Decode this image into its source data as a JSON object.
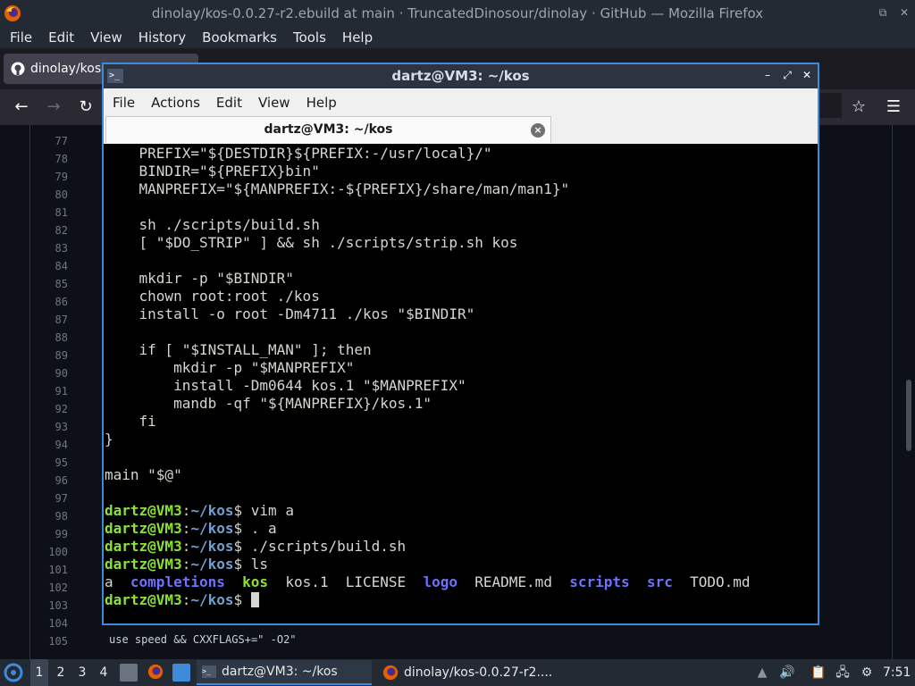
{
  "firefox": {
    "window_title": "dinolay/kos-0.0.27-r2.ebuild at main · TruncatedDinosour/dinolay · GitHub — Mozilla Firefox",
    "menu": [
      "File",
      "Edit",
      "View",
      "History",
      "Bookmarks",
      "Tools",
      "Help"
    ],
    "tab_title": "dinolay/kos-",
    "page_line_numbers": [
      "77",
      "78",
      "79",
      "80",
      "81",
      "82",
      "83",
      "84",
      "85",
      "86",
      "87",
      "88",
      "89",
      "90",
      "91",
      "92",
      "93",
      "94",
      "95",
      "96",
      "97",
      "98",
      "99",
      "100",
      "101",
      "102",
      "103",
      "104",
      "105"
    ],
    "visible_code_tail": "use speed && CXXFLAGS+=\" -O2\""
  },
  "terminal": {
    "window_title": "dartz@VM3: ~/kos",
    "menu": [
      "File",
      "Actions",
      "Edit",
      "View",
      "Help"
    ],
    "tab_title": "dartz@VM3: ~/kos",
    "script_lines": [
      "    PREFIX=\"${DESTDIR}${PREFIX:-/usr/local}/\"",
      "    BINDIR=\"${PREFIX}bin\"",
      "    MANPREFIX=\"${MANPREFIX:-${PREFIX}/share/man/man1}\"",
      "",
      "    sh ./scripts/build.sh",
      "    [ \"$DO_STRIP\" ] && sh ./scripts/strip.sh kos",
      "",
      "    mkdir -p \"$BINDIR\"",
      "    chown root:root ./kos",
      "    install -o root -Dm4711 ./kos \"$BINDIR\"",
      "",
      "    if [ \"$INSTALL_MAN\" ]; then",
      "        mkdir -p \"$MANPREFIX\"",
      "        install -Dm0644 kos.1 \"$MANPREFIX\"",
      "        mandb -qf \"${MANPREFIX}/kos.1\"",
      "    fi",
      "}",
      "",
      "main \"$@\"",
      ""
    ],
    "prompt_user": "dartz@VM3",
    "prompt_sep": ":",
    "prompt_path": "~/kos",
    "prompt_end": "$ ",
    "commands": [
      "vim a",
      ". a",
      "./scripts/build.sh",
      "ls",
      ""
    ],
    "ls_output": [
      {
        "name": "a",
        "type": "file"
      },
      {
        "name": "completions",
        "type": "dir"
      },
      {
        "name": "kos",
        "type": "exe"
      },
      {
        "name": "kos.1",
        "type": "file"
      },
      {
        "name": "LICENSE",
        "type": "file"
      },
      {
        "name": "logo",
        "type": "dir"
      },
      {
        "name": "README.md",
        "type": "file"
      },
      {
        "name": "scripts",
        "type": "dir"
      },
      {
        "name": "src",
        "type": "dir"
      },
      {
        "name": "TODO.md",
        "type": "file"
      }
    ]
  },
  "taskbar": {
    "workspaces": [
      "1",
      "2",
      "3",
      "4"
    ],
    "task_terminal": "dartz@VM3: ~/kos",
    "task_firefox": "dinolay/kos-0.0.27-r2....",
    "clock": "7:51"
  },
  "colors": {
    "accent": "#3d8bd9",
    "prompt_green": "#8ae234",
    "dir_blue": "#7070ff"
  }
}
